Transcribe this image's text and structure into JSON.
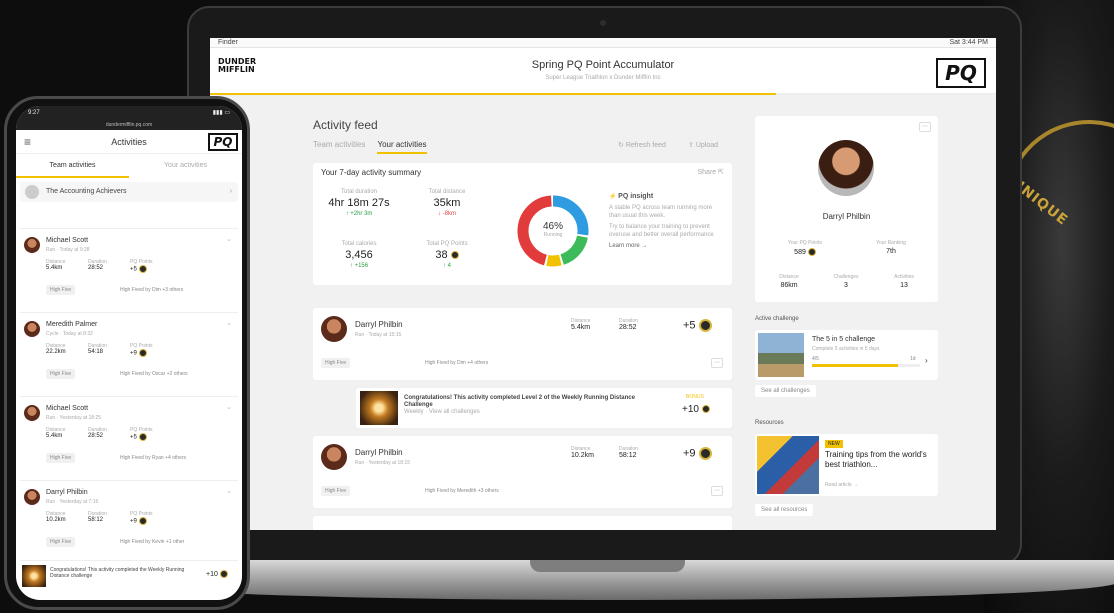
{
  "background": {
    "brand_text": "UNIQUE",
    "accent": "#c9a23a"
  },
  "menubar": {
    "app": "Finder",
    "clock": "Sat 3:44 PM"
  },
  "app": {
    "logo_text": "DUNDER MIFFLIN",
    "title": "Spring PQ Point Accumulator",
    "subtitle": "Super League Triathlon x Dunder Mifflin Inc",
    "pq_badge": "PQ",
    "progress": 0.72,
    "accent": "#f2c200"
  },
  "feed": {
    "heading": "Activity feed",
    "tabs": [
      {
        "label": "Team activities"
      },
      {
        "label": "Your activities"
      }
    ],
    "refresh_label": "Refresh feed",
    "upload_label": "Upload"
  },
  "summary": {
    "title": "Your 7-day activity summary",
    "share_label": "Share",
    "stats": [
      {
        "label": "Total duration",
        "value": "4hr 18m 27s",
        "change": "↑ +2hr 3m",
        "dir": "up"
      },
      {
        "label": "Total distance",
        "value": "35km",
        "change": "↓ -8km",
        "dir": "down"
      },
      {
        "label": "Total calories",
        "value": "3,456",
        "change": "↑ +156",
        "dir": "up"
      },
      {
        "label": "Total PQ Points",
        "value": "38",
        "change": "↑ 4",
        "dir": "up"
      }
    ],
    "donut_percent": "46%",
    "donut_sublabel": "Running",
    "donut_segments": [
      {
        "share": 0.28,
        "color": "#2f9be0"
      },
      {
        "share": 0.18,
        "color": "#3dbb5a"
      },
      {
        "share": 0.08,
        "color": "#f2c200"
      },
      {
        "share": 0.46,
        "color": "#e23b3b"
      }
    ],
    "insight_title": "PQ insight",
    "insight_text_1": "A stable PQ across team running more than usual this week.",
    "insight_text_2": "Try to balance your training to prevent overuse and better overall performance",
    "insight_link": "Learn more →"
  },
  "activities": [
    {
      "name": "Darryl Philbin",
      "meta": "Run · Today at 10:15",
      "distance_label": "Distance",
      "distance": "5.4km",
      "duration_label": "Duration",
      "duration": "28:52",
      "points": "+5",
      "tag": "High Five",
      "hf_text": "High Fived by Dim +4 others"
    },
    {
      "name": "Darryl Philbin",
      "meta": "Run · Yesterday at 18:15",
      "distance_label": "Distance",
      "distance": "10.2km",
      "duration_label": "Duration",
      "duration": "58:12",
      "points": "+9",
      "tag": "High Five",
      "hf_text": "High Fived by Meredith +3 others"
    }
  ],
  "congrats": {
    "text": "Congratulations! This activity completed Level 2 of the Weekly Running Distance Challenge",
    "link": "Weekly · View all challenges",
    "badge": "BONUS",
    "points": "+10"
  },
  "profile": {
    "name": "Darryl Philbin",
    "stats": [
      {
        "label": "Your PQ Points",
        "value": "589"
      },
      {
        "label": "Your Ranking",
        "value": "7th"
      },
      {
        "label": "Distance",
        "value": "86km"
      },
      {
        "label": "Challenges",
        "value": "3"
      },
      {
        "label": "Activities",
        "value": "13"
      }
    ]
  },
  "challenge": {
    "section": "Active challenge",
    "name": "The 5 in 5 challenge",
    "sub": "Complete 5 activities in 5 days",
    "progress_label": "4/5",
    "days_label": "1d",
    "progress": 0.8,
    "see_all": "See all challenges"
  },
  "resources": {
    "section": "Resources",
    "tag": "NEW",
    "title": "Training tips from the world's best triathlon...",
    "read": "Read article →",
    "see_all": "See all resources"
  },
  "phone": {
    "time": "9:27",
    "url": "dundermifflin.pq.com",
    "title": "Activities",
    "pq_badge": "PQ",
    "tabs": [
      {
        "label": "Team activities"
      },
      {
        "label": "Your activities"
      }
    ],
    "group": "The Accounting Achievers",
    "items": [
      {
        "name": "Michael Scott",
        "meta": "Run · Today at 9:28",
        "distance": "5.4km",
        "duration": "28:52",
        "points": "+5",
        "tag": "High Five",
        "hf": "High Fived by Dim +3 others"
      },
      {
        "name": "Meredith Palmer",
        "meta": "Cycle · Today at 8:32",
        "distance": "22.2km",
        "duration": "54:18",
        "points": "+9",
        "tag": "High Five",
        "hf": "High Fived by Oscar +2 others"
      },
      {
        "name": "Michael Scott",
        "meta": "Run · Yesterday at 18:25",
        "distance": "5.4km",
        "duration": "28:52",
        "points": "+5",
        "tag": "High Five",
        "hf": "High Fived by Ryan +4 others"
      },
      {
        "name": "Darryl Philbin",
        "meta": "Run · Yesterday at 7:15",
        "distance": "10.2km",
        "duration": "58:12",
        "points": "+9",
        "tag": "High Five",
        "hf": "High Fived by Kevin +1 other"
      }
    ],
    "labels": {
      "distance": "Distance",
      "duration": "Duration",
      "points": "PQ Points"
    },
    "congrats": "Congratulations! This activity completed the Weekly Running Distance challenge",
    "congrats_points": "+10"
  }
}
